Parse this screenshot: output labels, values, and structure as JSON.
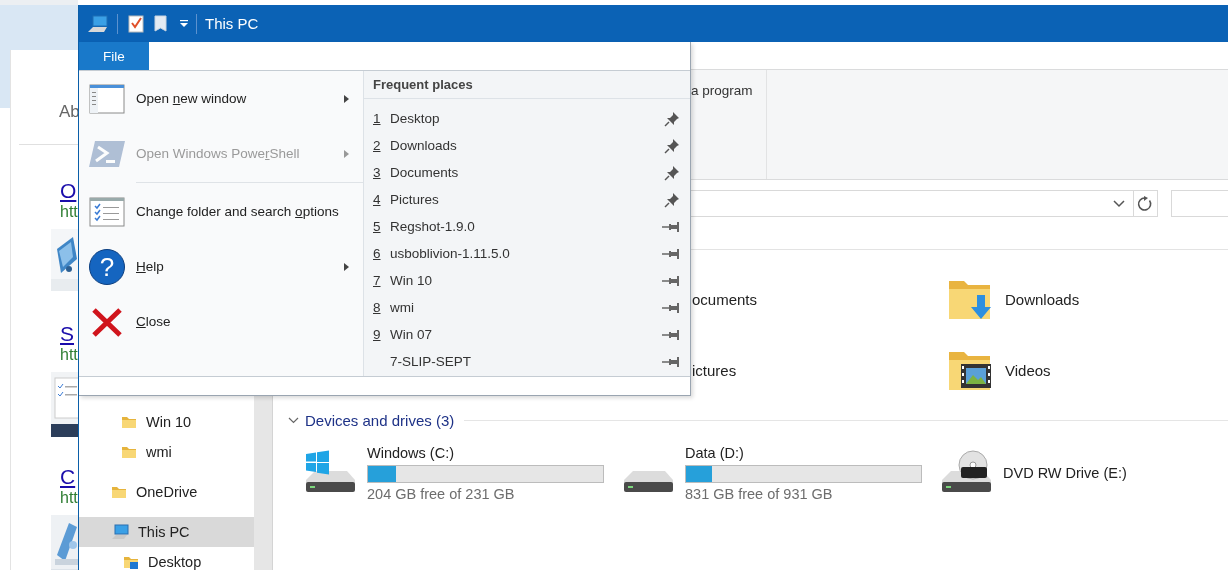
{
  "browser_background": {
    "heading": "Ab",
    "results": [
      {
        "title": "O",
        "url": "htt"
      },
      {
        "title": "S",
        "url": "htt"
      },
      {
        "title": "C",
        "url": "htt"
      }
    ]
  },
  "window": {
    "title": "This PC"
  },
  "ribbon_tabs": [
    {
      "label": "File",
      "selected": true
    }
  ],
  "ribbon": {
    "visible_command": "a program"
  },
  "file_menu": {
    "items": [
      {
        "kind": "new_window",
        "label": [
          {
            "text": "Open ",
            "access_key": false
          },
          {
            "text": "n",
            "access_key": true
          },
          {
            "text": "ew window",
            "access_key": false
          }
        ],
        "disabled": false,
        "submenu": true
      },
      {
        "kind": "powershell",
        "label": [
          {
            "text": "Open Windows Powe",
            "access_key": false
          },
          {
            "text": "r",
            "access_key": true
          },
          {
            "text": "Shell",
            "access_key": false
          }
        ],
        "disabled": true,
        "submenu": true
      },
      {
        "kind": "separator"
      },
      {
        "kind": "options",
        "label": [
          {
            "text": "Change folder and search ",
            "access_key": false
          },
          {
            "text": "o",
            "access_key": true
          },
          {
            "text": "ptions",
            "access_key": false
          }
        ],
        "disabled": false,
        "submenu": false
      },
      {
        "kind": "help",
        "icon_glyph": "?",
        "label": [
          {
            "text": "H",
            "access_key": true
          },
          {
            "text": "elp",
            "access_key": false
          }
        ],
        "disabled": false,
        "submenu": true
      },
      {
        "kind": "close",
        "label": [
          {
            "text": "C",
            "access_key": true
          },
          {
            "text": "lose",
            "access_key": false
          }
        ],
        "disabled": false,
        "submenu": false
      }
    ],
    "frequent_places_heading": "Frequent places",
    "frequent_places": [
      {
        "number": "1",
        "name": "Desktop",
        "pinned": true
      },
      {
        "number": "2",
        "name": "Downloads",
        "pinned": true
      },
      {
        "number": "3",
        "name": "Documents",
        "pinned": true
      },
      {
        "number": "4",
        "name": "Pictures",
        "pinned": true
      },
      {
        "number": "5",
        "name": "Regshot-1.9.0",
        "pinned": false
      },
      {
        "number": "6",
        "name": "usboblivion-1.11.5.0",
        "pinned": false
      },
      {
        "number": "7",
        "name": "Win 10",
        "pinned": false
      },
      {
        "number": "8",
        "name": "wmi",
        "pinned": false
      },
      {
        "number": "9",
        "name": "Win 07",
        "pinned": false
      },
      {
        "name": "7-SLIP-SEPT",
        "pinned": false
      }
    ]
  },
  "nav_pane": {
    "items": [
      {
        "kind": "pinned_folder",
        "label": "Win 10",
        "selected": false
      },
      {
        "kind": "pinned_folder",
        "label": "wmi",
        "selected": false
      },
      {
        "kind": "folder",
        "label": "OneDrive",
        "selected": false
      },
      {
        "kind": "computer",
        "label": "This PC",
        "selected": true,
        "children": [
          {
            "kind": "desktop",
            "label": "Desktop",
            "selected": false
          }
        ]
      }
    ]
  },
  "folders": [
    {
      "name": "ocuments"
    },
    {
      "kind": "downloads",
      "name": "Downloads"
    },
    {
      "name": "ictures"
    },
    {
      "kind": "videos",
      "name": "Videos"
    }
  ],
  "devices": {
    "heading": "Devices and drives (3)",
    "drives": [
      {
        "kind": "system",
        "name": "Windows (C:)",
        "level": 0.12,
        "free": "204 GB free of 231 GB"
      },
      {
        "kind": "hdd",
        "name": "Data (D:)",
        "level": 0.11,
        "free": "831 GB free of 931 GB"
      },
      {
        "kind": "dvd",
        "name": "DVD RW Drive (E:)"
      }
    ]
  }
}
